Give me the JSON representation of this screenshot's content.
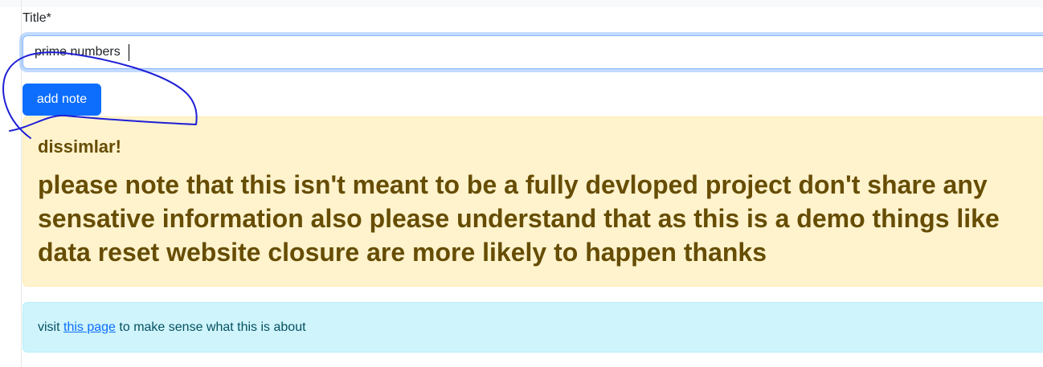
{
  "form": {
    "title_label": "Title*",
    "title_value": "prime numbers",
    "add_button_label": "add note"
  },
  "warning": {
    "heading": "dissimlar!",
    "message": "please note that this isn't meant to be a fully devloped project don't share any sensative information also please understand that as this is a demo things like data reset website closure are more likely to happen thanks"
  },
  "info": {
    "prefix": "visit",
    "link_text": "this page",
    "suffix": "to make sense what this is about"
  },
  "colors": {
    "primary": "#0d6efd",
    "warning_bg": "#fff3cd",
    "warning_text": "#664d03",
    "info_bg": "#cff4fc",
    "info_text": "#055160",
    "annotation": "#1f1fd6"
  },
  "annotation": {
    "icon": "hand-drawn-circle-icon"
  }
}
